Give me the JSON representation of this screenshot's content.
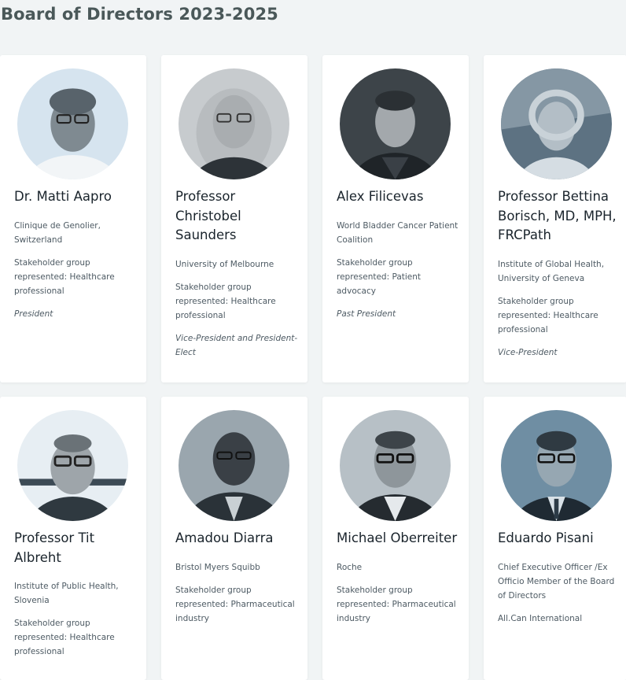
{
  "page": {
    "title": "Board of Directors 2023-2025"
  },
  "colors": {
    "background": "#f1f4f5",
    "card": "#ffffff",
    "title": "#4a5859",
    "text": "#4d5a63"
  },
  "members": [
    {
      "name": "Dr. Matti Aapro",
      "org": "Clinique de Genolier, Switzerland",
      "group": "Stakeholder group represented: Healthcare professional",
      "role": "President",
      "photo": "portrait-photo"
    },
    {
      "name": "Professor Christobel Saunders",
      "org": "University of Melbourne",
      "group": "Stakeholder group represented: Healthcare professional",
      "role": "Vice-President and President-Elect",
      "photo": "portrait-photo"
    },
    {
      "name": "Alex Filicevas",
      "org": "World Bladder Cancer Patient Coalition",
      "group": "Stakeholder group represented: Patient advocacy",
      "role": "Past President",
      "photo": "portrait-photo"
    },
    {
      "name": "Professor Bettina Borisch, MD, MPH, FRCPath",
      "org": "Institute of Global Health, University of Geneva",
      "group": "Stakeholder group represented: Healthcare professional",
      "role": "Vice-President",
      "photo": "portrait-photo"
    },
    {
      "name": "Professor Tit Albreht",
      "org": "Institute of Public Health, Slovenia",
      "group": "Stakeholder group represented: Healthcare professional",
      "role": "",
      "photo": "portrait-photo"
    },
    {
      "name": "Amadou Diarra",
      "org": "Bristol Myers Squibb",
      "group": "Stakeholder group represented: Pharmaceutical industry",
      "role": "",
      "photo": "portrait-photo"
    },
    {
      "name": "Michael Oberreiter",
      "org": "Roche",
      "group": "Stakeholder group represented: Pharmaceutical industry",
      "role": "",
      "photo": "portrait-photo"
    },
    {
      "name": "Eduardo Pisani",
      "org": "Chief Executive Officer /Ex Officio Member of the Board of Directors",
      "group": "All.Can International",
      "role": "",
      "photo": "portrait-photo"
    }
  ]
}
